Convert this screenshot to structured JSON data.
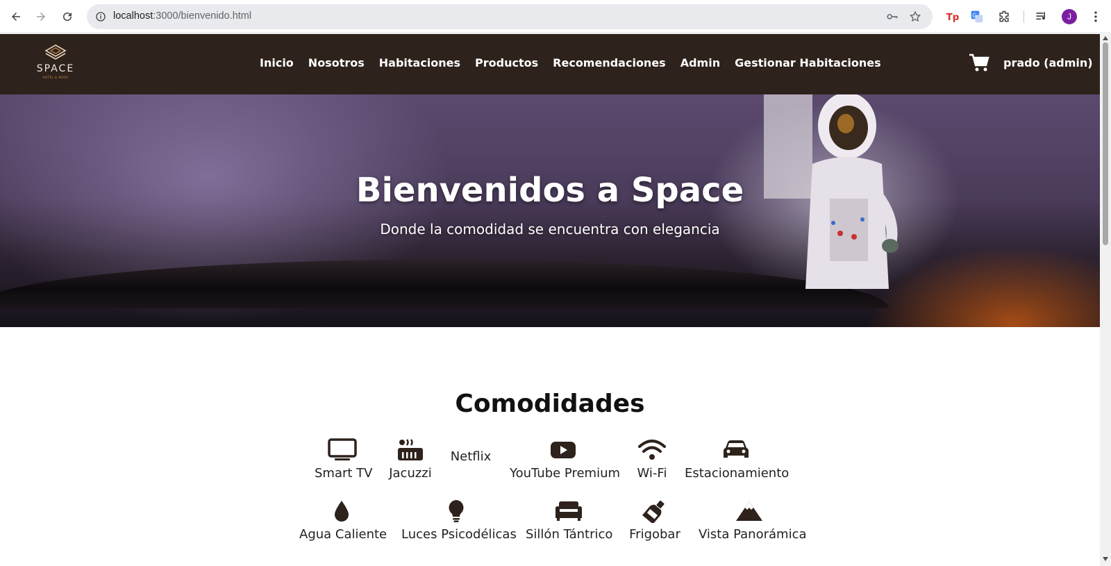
{
  "browser": {
    "url_host": "localhost",
    "url_path": ":3000/bienvenido.html",
    "avatar_initial": "J"
  },
  "header": {
    "logo_word": "SPACE",
    "logo_tag": "HOTEL & MORE",
    "nav": [
      "Inicio",
      "Nosotros",
      "Habitaciones",
      "Productos",
      "Recomendaciones",
      "Admin",
      "Gestionar Habitaciones"
    ],
    "user": "prado (admin)"
  },
  "hero": {
    "title": "Bienvenidos a Space",
    "subtitle": "Donde la comodidad se encuentra con elegancia"
  },
  "amenities": {
    "title": "Comodidades",
    "items": [
      {
        "label": "Smart TV",
        "icon": "tv-icon"
      },
      {
        "label": "Jacuzzi",
        "icon": "hot-tub-icon"
      },
      {
        "label": "Netflix",
        "icon": "none"
      },
      {
        "label": "YouTube Premium",
        "icon": "youtube-icon"
      },
      {
        "label": "Wi-Fi",
        "icon": "wifi-icon"
      },
      {
        "label": "Estacionamiento",
        "icon": "car-icon"
      },
      {
        "label": "Agua Caliente",
        "icon": "droplet-icon"
      },
      {
        "label": "Luces Psicodélicas",
        "icon": "lightbulb-icon"
      },
      {
        "label": "Sillón Tántrico",
        "icon": "couch-icon"
      },
      {
        "label": "Frigobar",
        "icon": "bottle-icon"
      },
      {
        "label": "Vista Panorámica",
        "icon": "mountain-icon"
      }
    ]
  },
  "colors": {
    "header_bg": "#2e221c",
    "icon_dark": "#2e221c"
  }
}
